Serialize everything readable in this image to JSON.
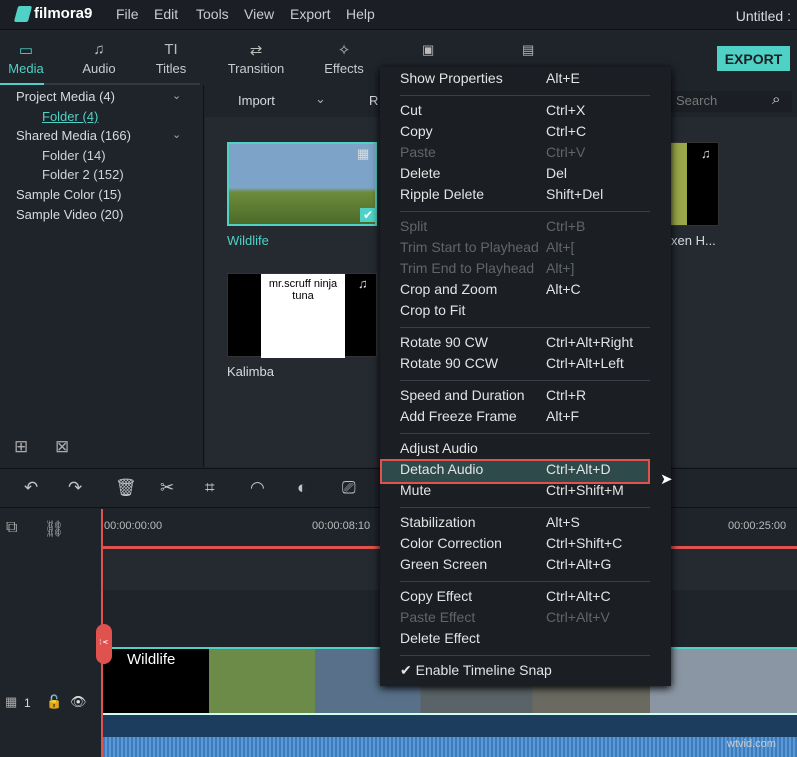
{
  "app": {
    "logo": "filmora9",
    "title": "Untitled :",
    "menu": [
      "File",
      "Edit",
      "Tools",
      "View",
      "Export",
      "Help"
    ]
  },
  "tabs": [
    {
      "label": "Media",
      "icon": "folder-icon"
    },
    {
      "label": "Audio",
      "icon": "music-icon"
    },
    {
      "label": "Titles",
      "icon": "titles-icon"
    },
    {
      "label": "Transition",
      "icon": "transition-icon"
    },
    {
      "label": "Effects",
      "icon": "effects-icon"
    }
  ],
  "export_label": "EXPORT",
  "sidebar": [
    {
      "label": "Project Media (4)"
    },
    {
      "label": "Folder (4)"
    },
    {
      "label": "Shared Media (166)"
    },
    {
      "label": "Folder (14)"
    },
    {
      "label": "Folder 2 (152)"
    },
    {
      "label": "Sample Color (15)"
    },
    {
      "label": "Sample Video (20)"
    }
  ],
  "library": {
    "import": "Import",
    "record": "R",
    "search_placeholder": "Search",
    "items": [
      {
        "label": "Wildlife"
      },
      {
        "label": "Kalimba"
      },
      {
        "label": "xen H..."
      }
    ],
    "album_text": "mr.scruff ninja tuna"
  },
  "timeline": {
    "t0": "00:00:00:00",
    "t1": "00:00:08:10",
    "t2": "00:00:25:00",
    "clip": "Wildlife",
    "track": "1"
  },
  "context_menu": [
    {
      "label": "Show Properties",
      "key": "Alt+E"
    },
    {
      "sep": true
    },
    {
      "label": "Cut",
      "key": "Ctrl+X"
    },
    {
      "label": "Copy",
      "key": "Ctrl+C"
    },
    {
      "label": "Paste",
      "key": "Ctrl+V",
      "disabled": true
    },
    {
      "label": "Delete",
      "key": "Del"
    },
    {
      "label": "Ripple Delete",
      "key": "Shift+Del"
    },
    {
      "sep": true
    },
    {
      "label": "Split",
      "key": "Ctrl+B",
      "disabled": true
    },
    {
      "label": "Trim Start to Playhead",
      "key": "Alt+[",
      "disabled": true
    },
    {
      "label": "Trim End to Playhead",
      "key": "Alt+]",
      "disabled": true
    },
    {
      "label": "Crop and Zoom",
      "key": "Alt+C"
    },
    {
      "label": "Crop to Fit",
      "key": ""
    },
    {
      "sep": true
    },
    {
      "label": "Rotate 90 CW",
      "key": "Ctrl+Alt+Right"
    },
    {
      "label": "Rotate 90 CCW",
      "key": "Ctrl+Alt+Left"
    },
    {
      "sep": true
    },
    {
      "label": "Speed and Duration",
      "key": "Ctrl+R"
    },
    {
      "label": "Add Freeze Frame",
      "key": "Alt+F"
    },
    {
      "sep": true
    },
    {
      "label": "Adjust Audio",
      "key": ""
    },
    {
      "label": "Detach Audio",
      "key": "Ctrl+Alt+D",
      "highlighted": true
    },
    {
      "label": "Mute",
      "key": "Ctrl+Shift+M"
    },
    {
      "sep": true
    },
    {
      "label": "Stabilization",
      "key": "Alt+S"
    },
    {
      "label": "Color Correction",
      "key": "Ctrl+Shift+C"
    },
    {
      "label": "Green Screen",
      "key": "Ctrl+Alt+G"
    },
    {
      "sep": true
    },
    {
      "label": "Copy Effect",
      "key": "Ctrl+Alt+C"
    },
    {
      "label": "Paste Effect",
      "key": "Ctrl+Alt+V",
      "disabled": true
    },
    {
      "label": "Delete Effect",
      "key": ""
    },
    {
      "sep": true
    },
    {
      "label": "✔ Enable Timeline Snap",
      "key": ""
    }
  ],
  "watermark": "wtvid.com"
}
